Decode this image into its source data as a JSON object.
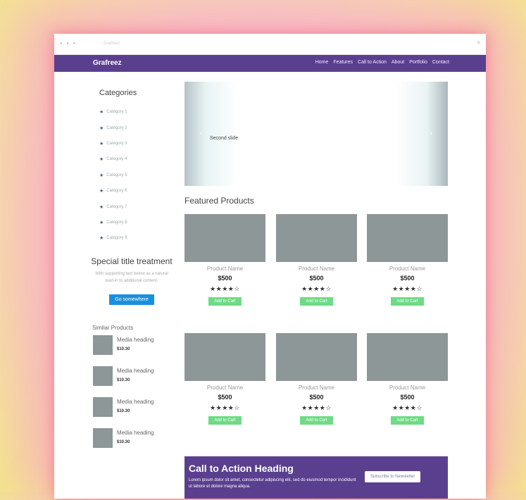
{
  "chrome": {
    "dots": "● ● ●",
    "url": "Grafreez",
    "menu": "≡"
  },
  "navbar": {
    "brand": "Grafreez",
    "links": [
      "Home",
      "Features",
      "Call to Action",
      "About",
      "Portfolio",
      "Contact"
    ]
  },
  "sidebar": {
    "title": "Categories",
    "items": [
      "Category 1",
      "Category 2",
      "Category 3",
      "Category 4",
      "Category 5",
      "Category 6",
      "Category 7",
      "Category 8",
      "Category 9"
    ],
    "special": {
      "title": "Special title treatment",
      "text": "With supporting text below as a natural lead-in to additional content.",
      "button": "Go somewhere"
    },
    "similar": {
      "title": "Similar Products",
      "items": [
        {
          "heading": "Media heading",
          "price": "$10.30"
        },
        {
          "heading": "Media heading",
          "price": "$10.30"
        },
        {
          "heading": "Media heading",
          "price": "$10.30"
        },
        {
          "heading": "Media heading",
          "price": "$10.30"
        }
      ]
    }
  },
  "carousel": {
    "caption": "Second slide",
    "prev": "‹",
    "next": "›"
  },
  "featured": {
    "title": "Featured Products",
    "products": [
      {
        "name": "Product Name",
        "price": "$500",
        "stars": "★★★★☆",
        "button": "Add to Cart"
      },
      {
        "name": "Product Name",
        "price": "$500",
        "stars": "★★★★☆",
        "button": "Add to Cart"
      },
      {
        "name": "Product Name",
        "price": "$500",
        "stars": "★★★★☆",
        "button": "Add to Cart"
      },
      {
        "name": "Product Name",
        "price": "$500",
        "stars": "★★★★☆",
        "button": "Add to Cart"
      },
      {
        "name": "Product Name",
        "price": "$500",
        "stars": "★★★★☆",
        "button": "Add to Cart"
      },
      {
        "name": "Product Name",
        "price": "$500",
        "stars": "★★★★☆",
        "button": "Add to Cart"
      }
    ]
  },
  "cta": {
    "heading": "Call to Action Heading",
    "text": "Lorem ipsum dolor sit amet, consectetur adipiscing elit, sed do eiusmod tempor incididunt ut labore et dolore magna aliqua.",
    "button": "Subscribe to Newsletter"
  },
  "colors": {
    "brand": "#5a3f8f",
    "primary": "#1a8fe0",
    "success": "#6edb86",
    "placeholder": "#8e9797"
  }
}
